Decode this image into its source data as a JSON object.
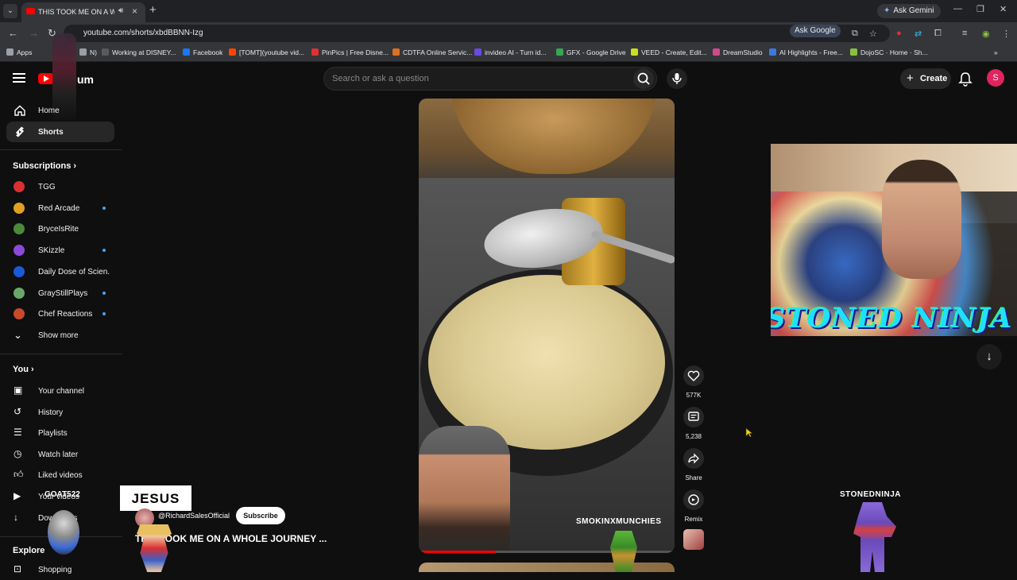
{
  "browser": {
    "tab_title": "THIS TOOK ME ON A WHOLE",
    "new_tab": "+",
    "gemini_label": "Ask Gemini",
    "url": "youtube.com/shorts/xbdBBNN-Izg",
    "ask_google": "Ask Google"
  },
  "bookmarks": [
    {
      "label": "Apps",
      "color": "#9aa0a6"
    },
    {
      "label": "N)",
      "color": "#9aa0a6"
    },
    {
      "label": "Working at DISNEY...",
      "color": "#5a5a5a"
    },
    {
      "label": "Facebook",
      "color": "#1877f2"
    },
    {
      "label": "[TOMT](youtube vid...",
      "color": "#ff4500"
    },
    {
      "label": "PinPics | Free Disne...",
      "color": "#e03030"
    },
    {
      "label": "CDTFA Online Servic...",
      "color": "#e07020"
    },
    {
      "label": "invideo AI - Turn id...",
      "color": "#6a4ae0"
    },
    {
      "label": "GFX - Google Drive",
      "color": "#34a853"
    },
    {
      "label": "VEED - Create, Edit...",
      "color": "#c8e020"
    },
    {
      "label": "DreamStudio",
      "color": "#d04a8a"
    },
    {
      "label": "AI Highlights - Free...",
      "color": "#3a7ae0"
    },
    {
      "label": "DojoSC · Home · Sh...",
      "color": "#8ac040"
    }
  ],
  "youtube": {
    "logo_tail": "um",
    "search_placeholder": "Search or ask a question",
    "create_label": "Create",
    "avatar_letter": "S"
  },
  "sidebar": {
    "home": "Home",
    "shorts": "Shorts",
    "subscriptions_heading": "Subscriptions",
    "subscriptions": [
      {
        "label": "TGG",
        "color": "#d83030",
        "new": false
      },
      {
        "label": "Red Arcade",
        "color": "#e0a020",
        "new": true
      },
      {
        "label": "BryceIsRite",
        "color": "#4a8a3a",
        "new": false
      },
      {
        "label": "SKizzle",
        "color": "#8a4ad8",
        "new": true
      },
      {
        "label": "Daily Dose of Scien...",
        "color": "#1a5ad8",
        "new": false
      },
      {
        "label": "GrayStillPlays",
        "color": "#6aa86a",
        "new": true
      },
      {
        "label": "Chef Reactions",
        "color": "#c84a2a",
        "new": true
      }
    ],
    "show_more": "Show more",
    "you_heading": "You",
    "you_items": [
      "Your channel",
      "History",
      "Playlists",
      "Watch later",
      "Liked videos",
      "Your videos",
      "Downloads"
    ],
    "explore_heading": "Explore",
    "shopping": "Shopping"
  },
  "short": {
    "watermark": "SMOKINXMUNCHIES",
    "channel": "@RichardSalesOfficial",
    "subscribe": "Subscribe",
    "title": "THIS TOOK ME ON A WHOLE JOURNEY ...",
    "progress": 0.3,
    "likes": "577K",
    "comments": "5,238",
    "share": "Share",
    "remix": "Remix"
  },
  "overlays": {
    "webcam_title": "STONED NINJA",
    "ninja_label": "STONEDNINJA",
    "goat_label": "GOAT522",
    "jesus_label": "JESUS"
  }
}
